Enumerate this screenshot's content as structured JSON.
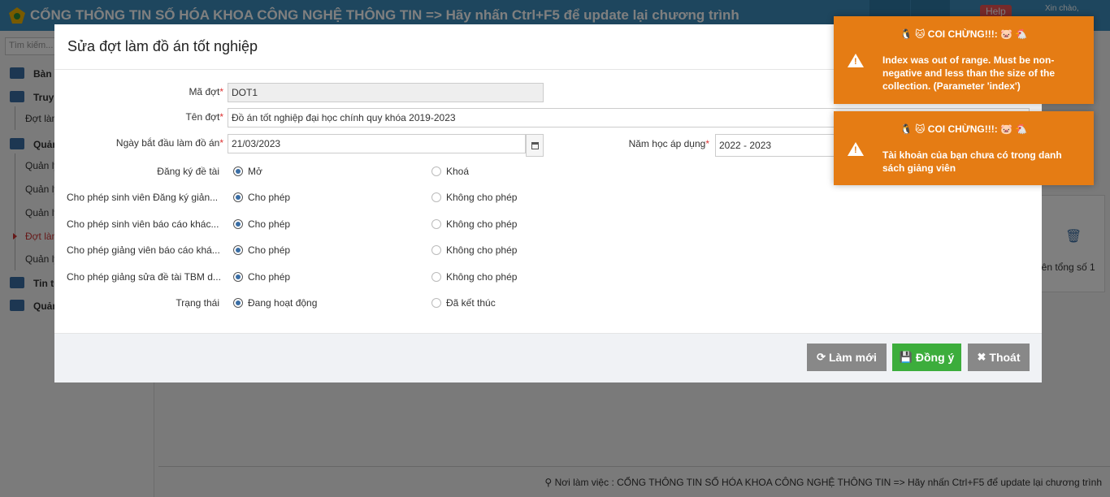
{
  "topbar": {
    "title": "CỔNG THÔNG TIN SỐ HÓA KHOA CÔNG NGHỆ THÔNG TIN => Hãy nhấn Ctrl+F5 để update lại chương trình",
    "help": "Help",
    "greeting": "Xin chào,"
  },
  "sidebar": {
    "search_placeholder": "Tìm kiếm...",
    "items": [
      {
        "label": "Bàn l"
      },
      {
        "label": "Truy"
      },
      {
        "label": "Đợt làm"
      },
      {
        "label": "Quản"
      },
      {
        "label": "Quản lý"
      },
      {
        "label": "Quản lý"
      },
      {
        "label": "Quản lý"
      },
      {
        "label": "Đợt làm"
      },
      {
        "label": "Quản lý"
      },
      {
        "label": "Tin tư"
      },
      {
        "label": "Quản"
      }
    ]
  },
  "background": {
    "panel_text": "iên tổng số 1",
    "footer": "Nơi làm việc : CỔNG THÔNG TIN SỐ HÓA KHOA CÔNG NGHỆ THÔNG TIN => Hãy nhấn Ctrl+F5 để update lại chương trình"
  },
  "modal": {
    "title": "Sửa đợt làm đồ án tốt nghiệp",
    "fields": {
      "ma_dot_label": "Mã đợt",
      "ma_dot_value": "DOT1",
      "ten_dot_label": "Tên đợt",
      "ten_dot_value": "Đồ án tốt nghiệp đại học chính quy khóa 2019-2023",
      "ngay_label": "Ngày bắt đầu làm đồ án",
      "ngay_value": "21/03/2023",
      "nam_hoc_label": "Năm học áp dụng",
      "nam_hoc_value": "2022 - 2023"
    },
    "radio_rows": [
      {
        "label": "Đăng ký đề tài",
        "opt1": "Mở",
        "opt2": "Khoá"
      },
      {
        "label": "Cho phép sinh viên Đăng ký giản...",
        "opt1": "Cho phép",
        "opt2": "Không cho phép"
      },
      {
        "label": "Cho phép sinh viên báo cáo khác...",
        "opt1": "Cho phép",
        "opt2": "Không cho phép"
      },
      {
        "label": "Cho phép giảng viên báo cáo khá...",
        "opt1": "Cho phép",
        "opt2": "Không cho phép"
      },
      {
        "label": "Cho phép giảng sửa đề tài TBM d...",
        "opt1": "Cho phép",
        "opt2": "Không cho phép"
      },
      {
        "label": "Trạng thái",
        "opt1": "Đang hoạt động",
        "opt2": "Đã kết thúc"
      }
    ],
    "buttons": {
      "refresh": "Làm mới",
      "ok": "Đồng ý",
      "exit": "Thoát"
    }
  },
  "toasts": [
    {
      "title": "🐧 🐱 COI CHỪNG!!!: 🐷 🐔",
      "message": "Index was out of range. Must be non-negative and less than the size of the collection. (Parameter 'index')"
    },
    {
      "title": "🐧 🐱 COI CHỪNG!!!: 🐷 🐔",
      "message": "Tài khoản của bạn chưa có trong danh sách giảng viên"
    }
  ],
  "colors": {
    "topbar": "#3c8dbc",
    "toast": "#e57c14",
    "ok_button": "#3cad3c",
    "gray_button": "#888888"
  }
}
